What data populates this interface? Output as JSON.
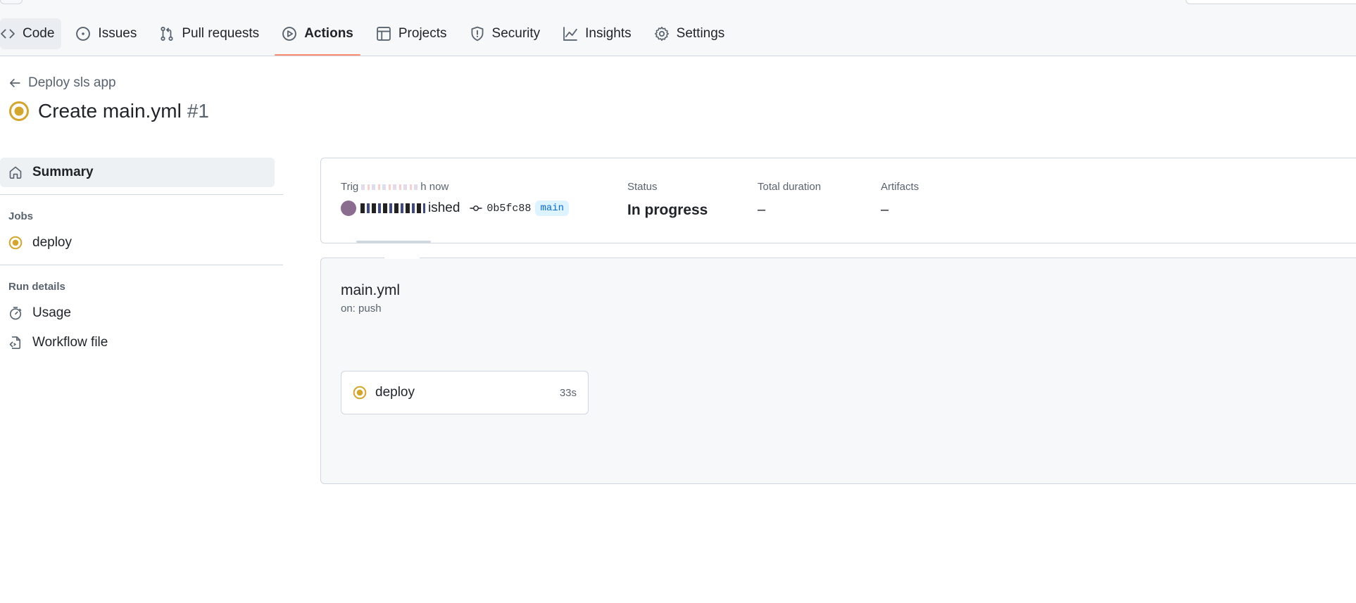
{
  "repo_nav": {
    "tabs": [
      {
        "label": "Code",
        "icon": "code-icon"
      },
      {
        "label": "Issues",
        "icon": "issue-opened-icon"
      },
      {
        "label": "Pull requests",
        "icon": "git-pull-request-icon"
      },
      {
        "label": "Actions",
        "icon": "play-icon",
        "active": true
      },
      {
        "label": "Projects",
        "icon": "table-icon"
      },
      {
        "label": "Security",
        "icon": "shield-icon"
      },
      {
        "label": "Insights",
        "icon": "graph-icon"
      },
      {
        "label": "Settings",
        "icon": "gear-icon"
      }
    ]
  },
  "header": {
    "back_label": "Deploy sls app",
    "run_title": "Create main.yml",
    "run_number": "#1",
    "status_color": "#d4a72c"
  },
  "sidebar": {
    "summary_label": "Summary",
    "jobs_heading": "Jobs",
    "jobs": [
      {
        "label": "deploy"
      }
    ],
    "run_details_heading": "Run details",
    "run_details": [
      {
        "label": "Usage",
        "icon": "stopwatch-icon"
      },
      {
        "label": "Workflow file",
        "icon": "file-code-icon"
      }
    ]
  },
  "summary": {
    "triggered_label_prefix": "Trig",
    "triggered_label_suffix": "h now",
    "pushed_text": "ished",
    "commit_sha": "0b5fc88",
    "branch": "main",
    "status_label": "Status",
    "status_value": "In progress",
    "duration_label": "Total duration",
    "duration_value": "–",
    "artifacts_label": "Artifacts",
    "artifacts_value": "–"
  },
  "workflow": {
    "file_name": "main.yml",
    "trigger": "on: push",
    "jobs": [
      {
        "name": "deploy",
        "duration": "33s"
      }
    ]
  },
  "colors": {
    "accent_underline": "#fd8c73",
    "in_progress": "#d4a72c",
    "branch_text": "#0969da",
    "branch_bg": "#ddf4ff"
  }
}
